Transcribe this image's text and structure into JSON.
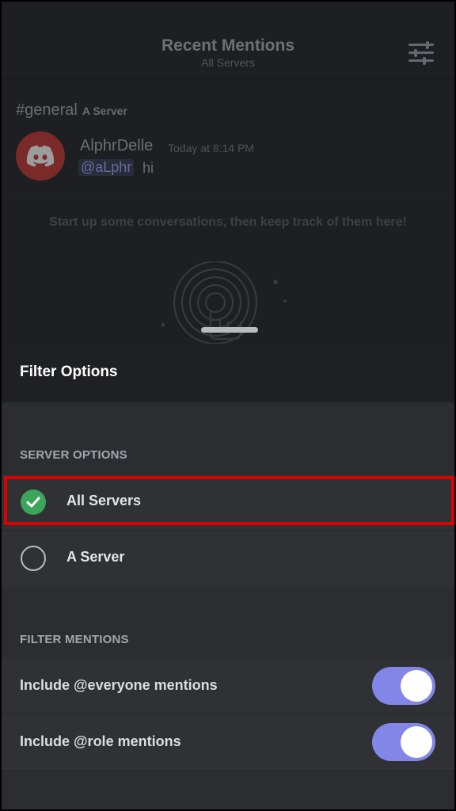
{
  "header": {
    "title": "Recent Mentions",
    "subtitle": "All Servers",
    "filter_icon": "sliders-icon"
  },
  "mention": {
    "channel": "#general",
    "server": "A Server",
    "author": "AlphrDelle",
    "timestamp": "Today at 8:14 PM",
    "mention_tag": "@aLphr",
    "text": "hi",
    "avatar_icon": "discord-logo-icon",
    "avatar_color": "#7a2a29"
  },
  "empty_state": {
    "text": "Start up some conversations, then keep track of them here!"
  },
  "sheet": {
    "title": "Filter Options",
    "server_options_label": "SERVER OPTIONS",
    "server_options": [
      {
        "label": "All Servers",
        "selected": true
      },
      {
        "label": "A Server",
        "selected": false
      }
    ],
    "filter_mentions_label": "FILTER MENTIONS",
    "filter_mentions": [
      {
        "label": "Include @everyone mentions",
        "enabled": true
      },
      {
        "label": "Include @role mentions",
        "enabled": true
      }
    ]
  },
  "colors": {
    "accent_toggle": "#8286e6",
    "selected_check": "#3ba55c",
    "highlight_box": "#e00000"
  }
}
